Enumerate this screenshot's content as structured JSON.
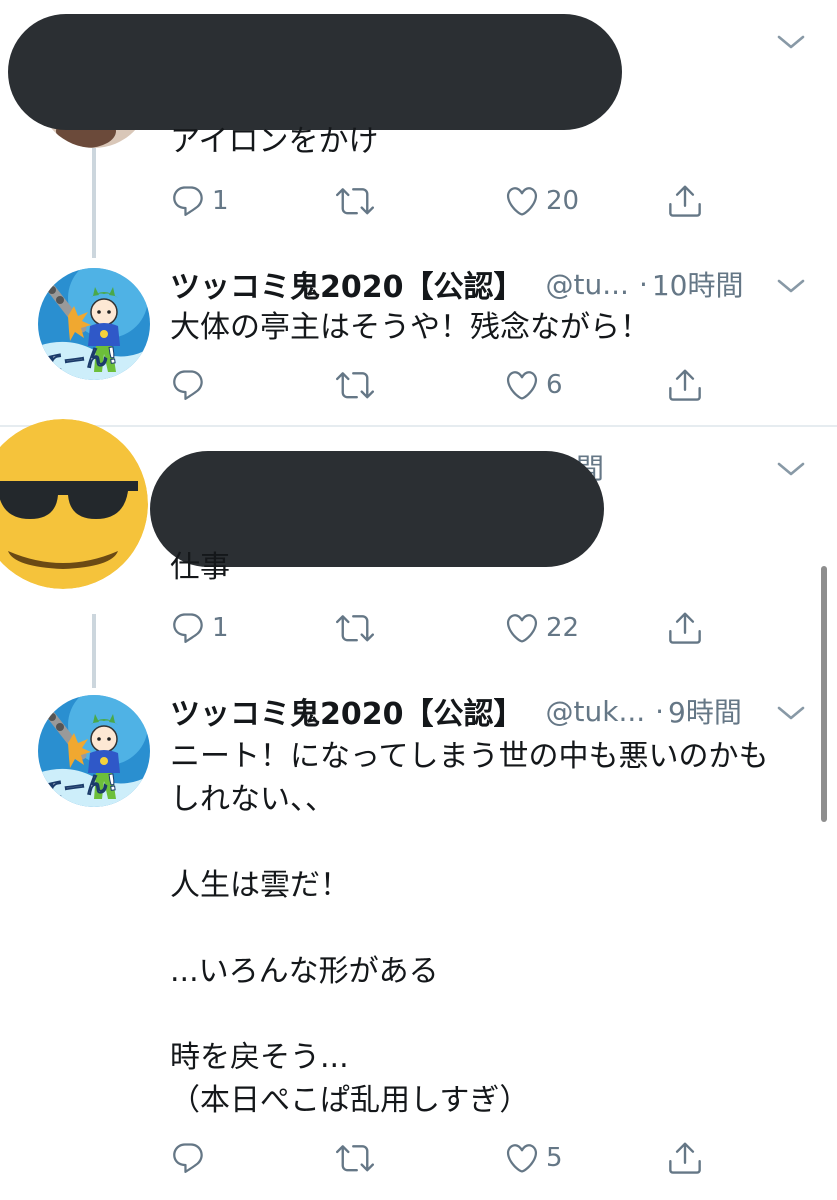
{
  "tweets": [
    {
      "text": "アイロンをかけ",
      "replies": "1",
      "likes": "20"
    },
    {
      "display_name": "ツッコミ鬼2020【公認】",
      "handle": "@tu...",
      "dot": "·",
      "time": "10時間",
      "text": "大体の亭主はそうや！残念ながら！",
      "likes": "6"
    },
    {
      "time_partial": "間",
      "text": "仕事",
      "replies": "1",
      "likes": "22"
    },
    {
      "display_name": "ツッコミ鬼2020【公認】",
      "handle": "@tuk...",
      "dot": "·",
      "time": "9時間",
      "text": "ニート！になってしまう世の中も悪いのかも\nしれない、、\n\n人生は雲だ！\n\n...いろんな形がある\n\n時を戻そう...\n（本日ぺこぱ乱用しすぎ）",
      "likes": "5"
    }
  ],
  "icons": [
    "reply-icon",
    "retweet-icon",
    "like-icon",
    "share-icon",
    "chevron-down-icon"
  ],
  "colors": {
    "icon": "#657786",
    "text": "#14171a",
    "divider": "#e6ecf0",
    "thread": "#ccd6dd",
    "redaction": "#2b2f33",
    "emoji": "#f5c33b"
  }
}
